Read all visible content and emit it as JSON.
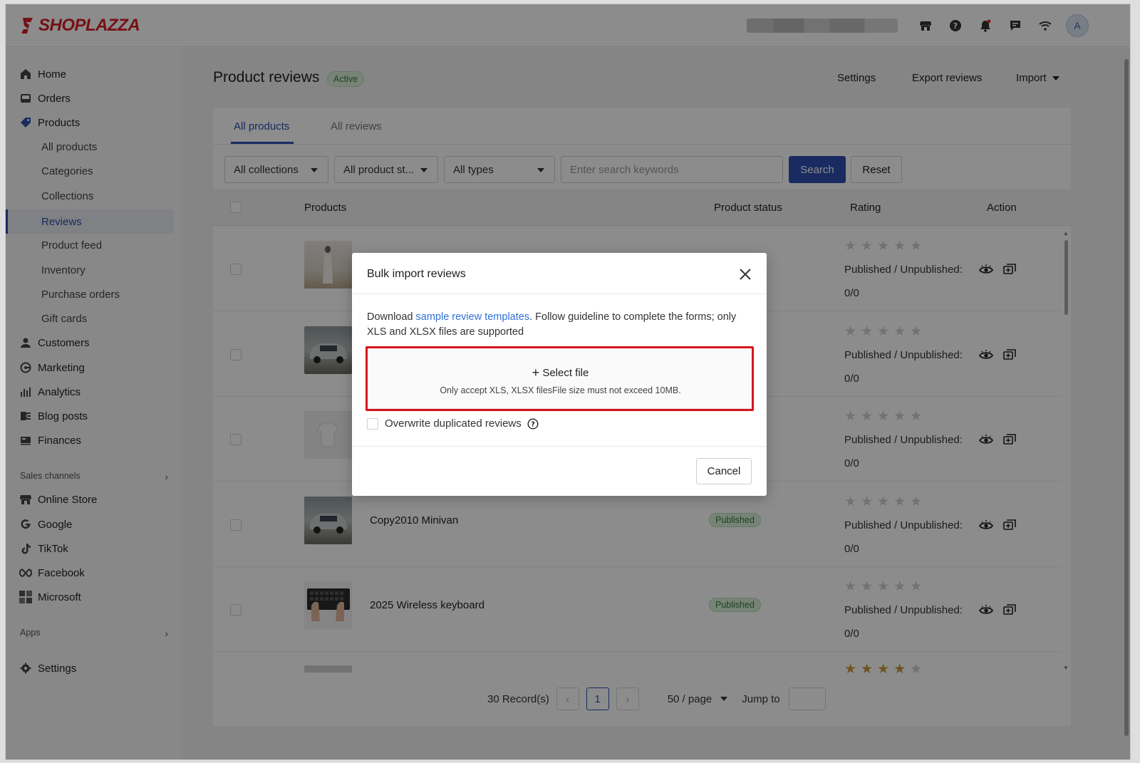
{
  "brand": {
    "name": "SHOPLAZZA",
    "color": "#d62027"
  },
  "header": {
    "icons": [
      "store-icon",
      "help-icon",
      "bell-icon",
      "chat-icon",
      "wifi-icon"
    ],
    "avatar_initial": "A"
  },
  "sidebar": {
    "items": [
      {
        "label": "Home",
        "icon": "home-icon"
      },
      {
        "label": "Orders",
        "icon": "inbox-icon"
      },
      {
        "label": "Products",
        "icon": "tag-icon"
      },
      {
        "label": "Customers",
        "icon": "person-icon"
      },
      {
        "label": "Marketing",
        "icon": "megaphone-icon"
      },
      {
        "label": "Analytics",
        "icon": "bar-chart-icon"
      },
      {
        "label": "Blog posts",
        "icon": "blog-icon"
      },
      {
        "label": "Finances",
        "icon": "finance-icon"
      }
    ],
    "product_sub": [
      "All products",
      "Categories",
      "Collections",
      "Reviews",
      "Product feed",
      "Inventory",
      "Purchase orders",
      "Gift cards"
    ],
    "active_sub": "Reviews",
    "sales_channels_label": "Sales channels",
    "channels": [
      {
        "label": "Online Store",
        "icon": "store-icon"
      },
      {
        "label": "Google",
        "icon": "google-icon"
      },
      {
        "label": "TikTok",
        "icon": "tiktok-icon"
      },
      {
        "label": "Facebook",
        "icon": "meta-icon"
      },
      {
        "label": "Microsoft",
        "icon": "microsoft-icon"
      }
    ],
    "apps_label": "Apps",
    "settings_label": "Settings"
  },
  "page": {
    "title": "Product reviews",
    "status": "Active",
    "actions": {
      "settings": "Settings",
      "export": "Export reviews",
      "import": "Import"
    },
    "tabs": [
      "All products",
      "All reviews"
    ],
    "filters": {
      "collections": "All collections",
      "product_status": "All product st...",
      "types": "All types",
      "search_placeholder": "Enter search keywords",
      "search_button": "Search",
      "reset_button": "Reset"
    },
    "columns": [
      "Products",
      "Product status",
      "Rating",
      "Action"
    ],
    "rows": [
      {
        "name": "",
        "status": "",
        "pub_label": "Published / Unpublished:",
        "count": "0/0"
      },
      {
        "name": "",
        "status": "",
        "pub_label": "Published / Unpublished:",
        "count": "0/0"
      },
      {
        "name": "",
        "status": "",
        "pub_label": "Published / Unpublished:",
        "count": "0/0"
      },
      {
        "name": "Copy2010 Minivan",
        "status": "Published",
        "pub_label": "Published / Unpublished:",
        "count": "0/0"
      },
      {
        "name": "2025 Wireless keyboard",
        "status": "Published",
        "pub_label": "Published / Unpublished:",
        "count": "0/0"
      }
    ],
    "pagination": {
      "records": "30 Record(s)",
      "current_page": "1",
      "per_page": "50 / page",
      "jump_label": "Jump to"
    }
  },
  "modal": {
    "title": "Bulk import reviews",
    "desc_prefix": "Download ",
    "desc_link": "sample review templates",
    "desc_suffix": ". Follow guideline to complete the forms; only XLS and XLSX files are supported",
    "select_file": "Select file",
    "file_hint": "Only accept XLS, XLSX filesFile size must not exceed 10MB.",
    "overwrite_label": "Overwrite duplicated reviews",
    "cancel": "Cancel"
  },
  "colors": {
    "primary": "#2f4fb1",
    "link": "#2f6fd6",
    "highlight": "#d7141c",
    "success_bg": "#d9efd8"
  }
}
